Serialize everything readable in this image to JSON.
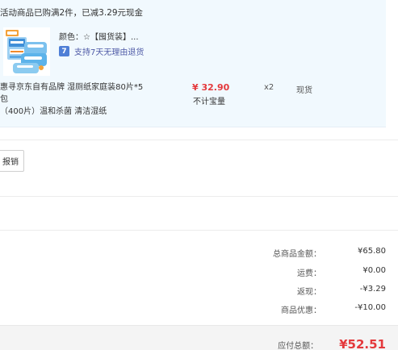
{
  "colors": {
    "promo_bg": "#f1f9fe",
    "price_red": "#e4393c",
    "link_blue": "#4e5aa6",
    "icon_blue": "#4f7fd6"
  },
  "promo": {
    "text": "活动商品已购满2件，已减3.29元现金"
  },
  "item": {
    "thumbnail_icon": "wet-wipes-product-image",
    "sku_label": "颜色：",
    "sku_value": "☆【囤货装】...",
    "return_icon": "seven-day-return-icon",
    "return_icon_glyph": "7",
    "return_text": "支持7天无理由退货",
    "name_line1": "惠寻京东自有品牌 湿厕纸家庭装80片*5包",
    "name_line2": "（400片）温和杀菌 清洁湿纸",
    "price": "¥ 32.90",
    "points_note": "不计宝量",
    "quantity": "x2",
    "stock_status": "现货"
  },
  "actions": {
    "reimburse_label": "报销"
  },
  "summary": {
    "total_label": "总商品金额：",
    "total_value": "¥65.80",
    "shipping_label": "运费：",
    "shipping_value": "¥0.00",
    "rebate_label": "返现：",
    "rebate_value": "-¥3.29",
    "discount_label": "商品优惠：",
    "discount_value": "-¥10.00",
    "pay_label": "应付总额：",
    "pay_value": "¥52.51"
  }
}
